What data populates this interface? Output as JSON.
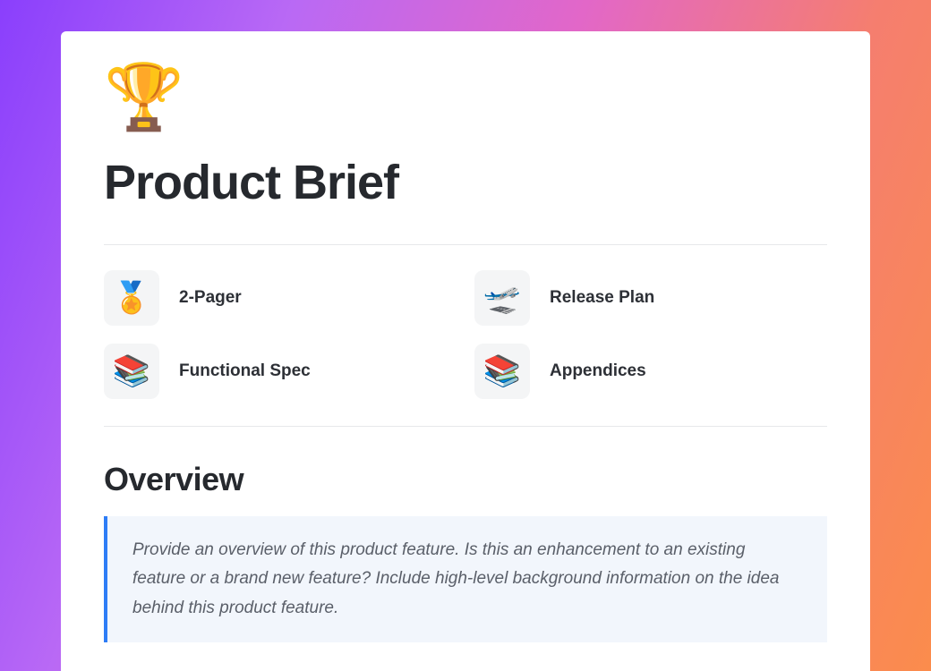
{
  "hero_icon": "🏆",
  "page_title": "Product Brief",
  "nav": {
    "items": [
      {
        "icon": "🏅",
        "label": "2-Pager"
      },
      {
        "icon": "🛫",
        "label": "Release Plan"
      },
      {
        "icon": "📚",
        "label": "Functional Spec"
      },
      {
        "icon": "📚",
        "label": "Appendices"
      }
    ]
  },
  "overview": {
    "heading": "Overview",
    "callout_text": "Provide an overview of this product feature. Is this an enhancement to an existing feature or a brand new feature? Include high-level background information on the idea behind this product feature."
  }
}
